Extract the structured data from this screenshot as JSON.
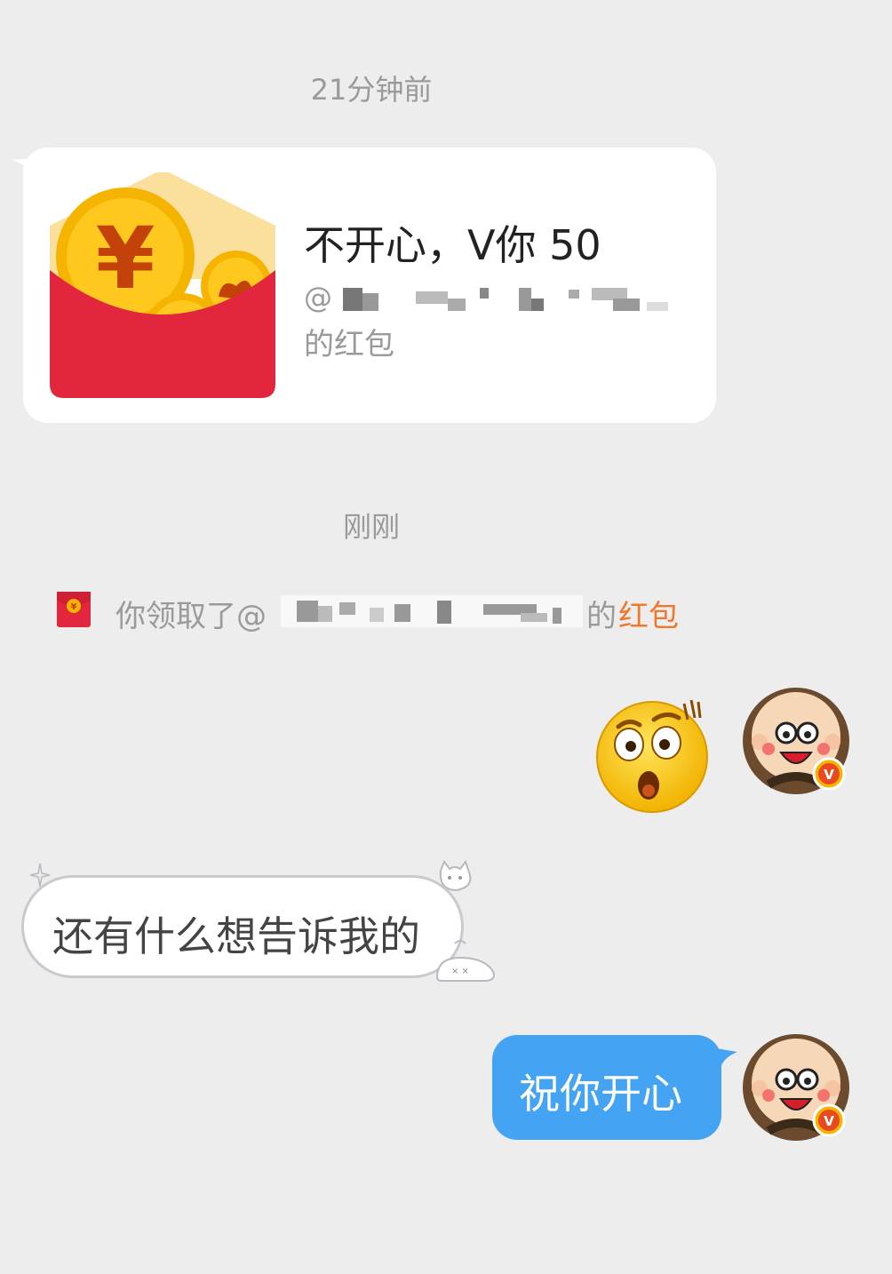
{
  "timestamps": [
    "21分钟前",
    "刚刚"
  ],
  "red_packet": {
    "title": "不开心，V你 50",
    "sender_prefix": "@",
    "suffix": "的红包",
    "icon": "red-envelope-icon"
  },
  "notice": {
    "prefix": "你领取了@",
    "of": "的",
    "link": "红包",
    "link_color": "#f0782c",
    "icon": "red-envelope-small-icon"
  },
  "messages": {
    "sent_emoji": "shocked-face-emoji",
    "received_text": "还有什么想告诉我的",
    "sent_text": "祝你开心"
  },
  "colors": {
    "background": "#ededed",
    "outgoing_bubble": "#45a3f4",
    "red_packet": "#e2263d"
  }
}
